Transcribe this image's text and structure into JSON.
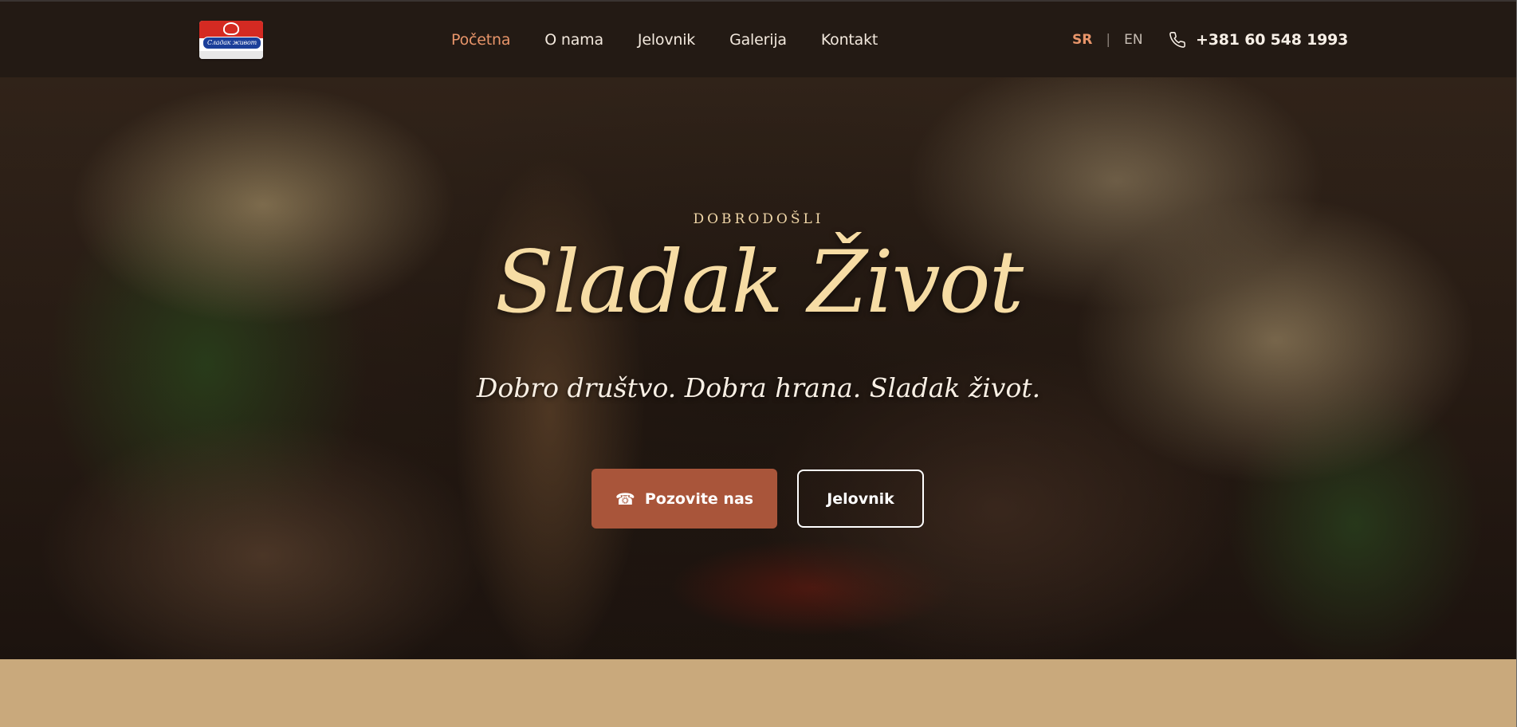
{
  "logo": {
    "text": "Сладак живот"
  },
  "nav": {
    "items": [
      {
        "label": "Početna",
        "active": true
      },
      {
        "label": "O nama",
        "active": false
      },
      {
        "label": "Jelovnik",
        "active": false
      },
      {
        "label": "Galerija",
        "active": false
      },
      {
        "label": "Kontakt",
        "active": false
      }
    ]
  },
  "language": {
    "sr": "SR",
    "separator": "|",
    "en": "EN",
    "active": "SR"
  },
  "contact": {
    "phone_icon": "phone-icon",
    "phone": "+381 60 548 1993"
  },
  "hero": {
    "eyebrow": "DOBRODOŠLI",
    "title": "Sladak Život",
    "tagline": "Dobro društvo. Dobra hrana. Sladak život.",
    "call_button": {
      "icon": "telephone-icon",
      "glyph": "☎",
      "label": "Pozovite nas"
    },
    "menu_button": {
      "label": "Jelovnik"
    }
  },
  "colors": {
    "header_bg": "#231a14",
    "accent": "#e8956a",
    "button_bg": "#a9553a",
    "title": "#f6dca4",
    "section_bg": "#c9a97c"
  }
}
